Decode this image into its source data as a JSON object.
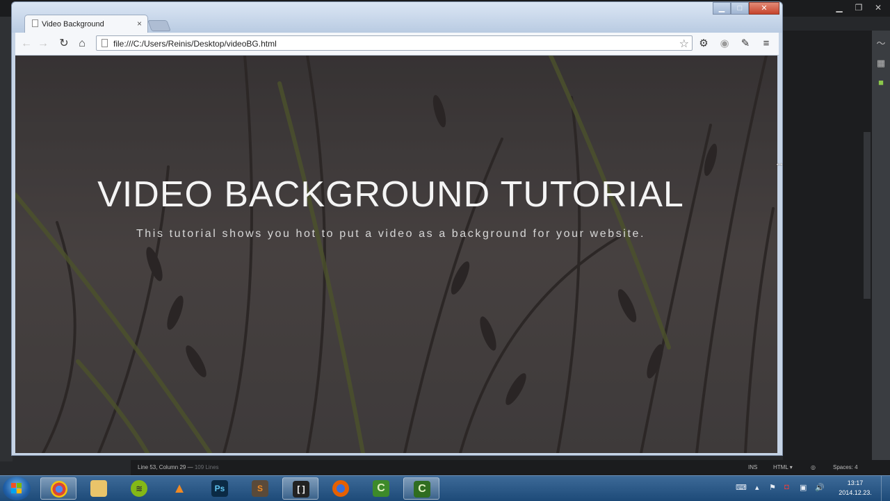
{
  "browser": {
    "tab_title": "Video Background",
    "tab_close": "×",
    "url": "file:///C:/Users/Reinis/Desktop/videoBG.html"
  },
  "page": {
    "headline": "VIDEO BACKGROUND TUTORIAL",
    "subtitle": "This tutorial shows you hot to put a video as a background for your website."
  },
  "editor": {
    "status_position": "Line 53, Column 29 —",
    "status_lines": "109 Lines",
    "status_ins": "INS",
    "status_lang": "HTML ▾",
    "status_spaces": "Spaces: 4"
  },
  "taskbar": {
    "clock_time": "13:17",
    "clock_date": "2014.12.23."
  },
  "icons": {
    "back": "back-arrow-icon",
    "forward": "forward-arrow-icon",
    "reload": "reload-icon",
    "home": "home-icon",
    "bookmark": "star-icon",
    "settings": "gear-icon",
    "menu": "hamburger-menu-icon"
  }
}
